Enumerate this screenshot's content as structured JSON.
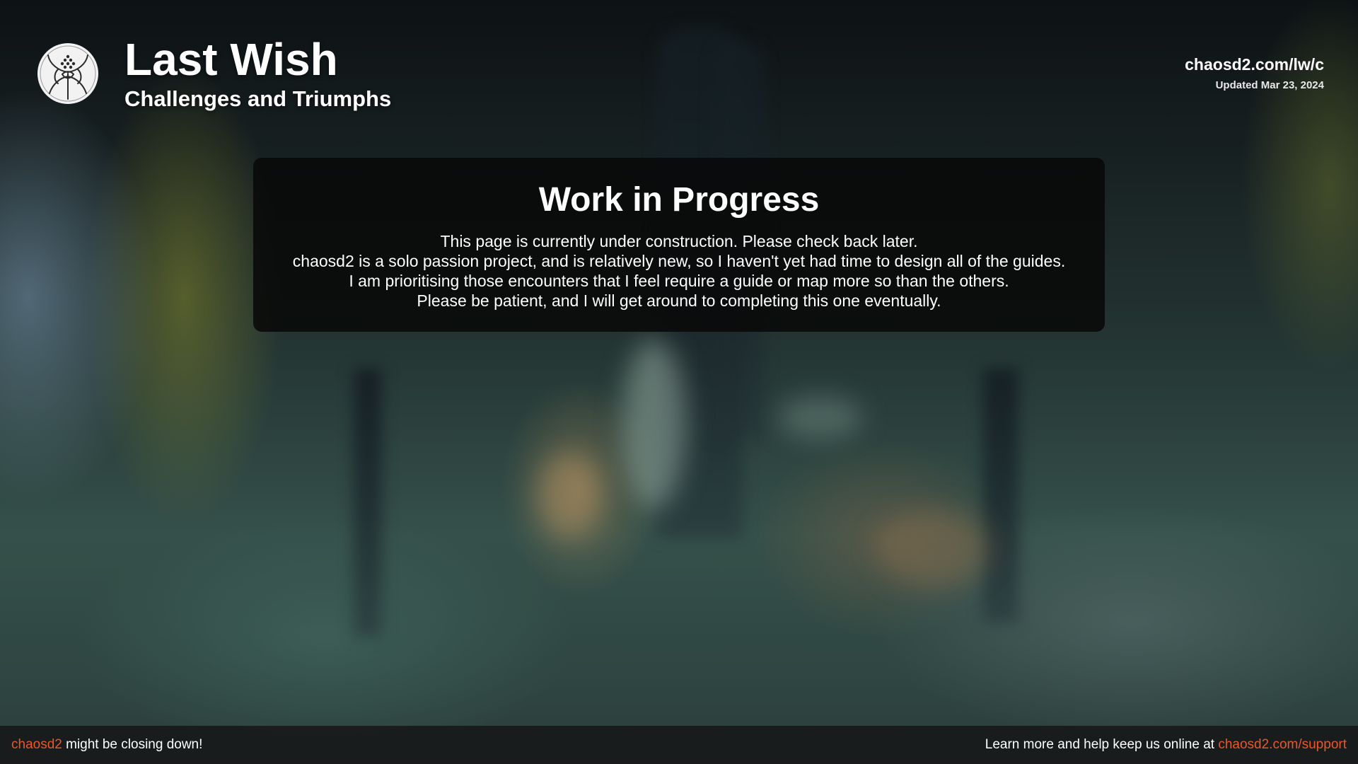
{
  "colors": {
    "accent": "#e8582a",
    "panel_background": "#080808",
    "footer_background": "#181a1b",
    "text": "#ffffff"
  },
  "header": {
    "logo_icon": "raid-emblem-icon",
    "title": "Last Wish",
    "subtitle": "Challenges and Triumphs",
    "site_url": "chaosd2.com/lw/c",
    "updated": "Updated Mar 23, 2024"
  },
  "notice": {
    "heading": "Work in Progress",
    "lines": [
      "This page is currently under construction. Please check back later.",
      "chaosd2 is a solo passion project, and is relatively new, so I haven't yet had time to design all of the guides.",
      "I am prioritising those encounters that I feel require a guide or map more so than the others.",
      "Please be patient, and I will get around to completing this one eventually."
    ]
  },
  "footer": {
    "left_link": "chaosd2",
    "left_text": " might be closing down!",
    "right_text": "Learn more and help keep us online at ",
    "right_link": "chaosd2.com/support"
  }
}
